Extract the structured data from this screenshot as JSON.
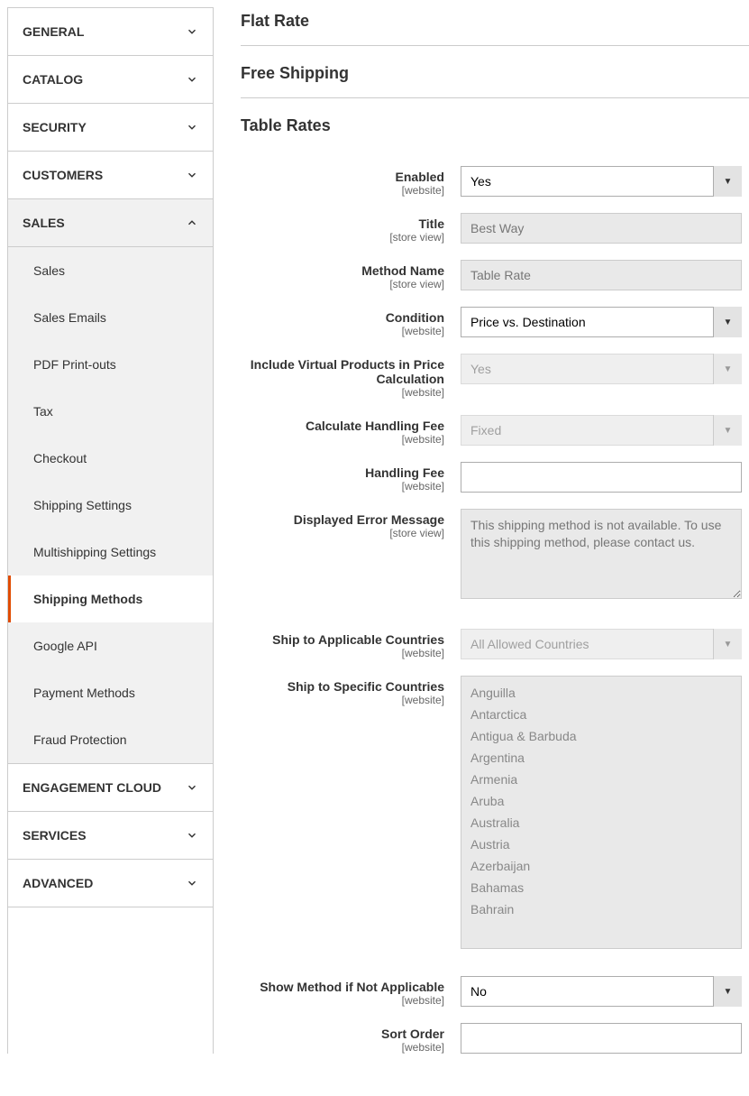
{
  "sidebar": {
    "sections": [
      {
        "label": "GENERAL",
        "expanded": false
      },
      {
        "label": "CATALOG",
        "expanded": false
      },
      {
        "label": "SECURITY",
        "expanded": false
      },
      {
        "label": "CUSTOMERS",
        "expanded": false
      },
      {
        "label": "SALES",
        "expanded": true
      },
      {
        "label": "ENGAGEMENT CLOUD",
        "expanded": false
      },
      {
        "label": "SERVICES",
        "expanded": false
      },
      {
        "label": "ADVANCED",
        "expanded": false
      }
    ],
    "sales_items": [
      {
        "label": "Sales"
      },
      {
        "label": "Sales Emails"
      },
      {
        "label": "PDF Print-outs"
      },
      {
        "label": "Tax"
      },
      {
        "label": "Checkout"
      },
      {
        "label": "Shipping Settings"
      },
      {
        "label": "Multishipping Settings"
      },
      {
        "label": "Shipping Methods",
        "active": true
      },
      {
        "label": "Google API"
      },
      {
        "label": "Payment Methods"
      },
      {
        "label": "Fraud Protection"
      }
    ]
  },
  "main": {
    "sections": {
      "flat_rate": "Flat Rate",
      "free_shipping": "Free Shipping",
      "table_rates": "Table Rates"
    },
    "fields": {
      "enabled": {
        "label": "Enabled",
        "scope": "[website]",
        "value": "Yes",
        "disabled": false,
        "type": "select"
      },
      "title": {
        "label": "Title",
        "scope": "[store view]",
        "value": "Best Way",
        "disabled": true,
        "type": "text"
      },
      "method_name": {
        "label": "Method Name",
        "scope": "[store view]",
        "value": "Table Rate",
        "disabled": true,
        "type": "text"
      },
      "condition": {
        "label": "Condition",
        "scope": "[website]",
        "value": "Price vs. Destination",
        "disabled": false,
        "type": "select"
      },
      "include_virtual": {
        "label": "Include Virtual Products in Price Calculation",
        "scope": "[website]",
        "value": "Yes",
        "disabled": true,
        "type": "select"
      },
      "calc_handling": {
        "label": "Calculate Handling Fee",
        "scope": "[website]",
        "value": "Fixed",
        "disabled": true,
        "type": "select"
      },
      "handling_fee": {
        "label": "Handling Fee",
        "scope": "[website]",
        "value": "",
        "disabled": false,
        "type": "text"
      },
      "error_msg": {
        "label": "Displayed Error Message",
        "scope": "[store view]",
        "value": "This shipping method is not available. To use this shipping method, please contact us.",
        "disabled": true,
        "type": "textarea"
      },
      "ship_applicable": {
        "label": "Ship to Applicable Countries",
        "scope": "[website]",
        "value": "All Allowed Countries",
        "disabled": true,
        "type": "select"
      },
      "ship_specific": {
        "label": "Ship to Specific Countries",
        "scope": "[website]",
        "disabled": true,
        "type": "multiselect",
        "options": [
          "Anguilla",
          "Antarctica",
          "Antigua & Barbuda",
          "Argentina",
          "Armenia",
          "Aruba",
          "Australia",
          "Austria",
          "Azerbaijan",
          "Bahamas",
          "Bahrain"
        ]
      },
      "show_method": {
        "label": "Show Method if Not Applicable",
        "scope": "[website]",
        "value": "No",
        "disabled": false,
        "type": "select"
      },
      "sort_order": {
        "label": "Sort Order",
        "scope": "[website]",
        "value": "",
        "disabled": false,
        "type": "text"
      }
    }
  }
}
